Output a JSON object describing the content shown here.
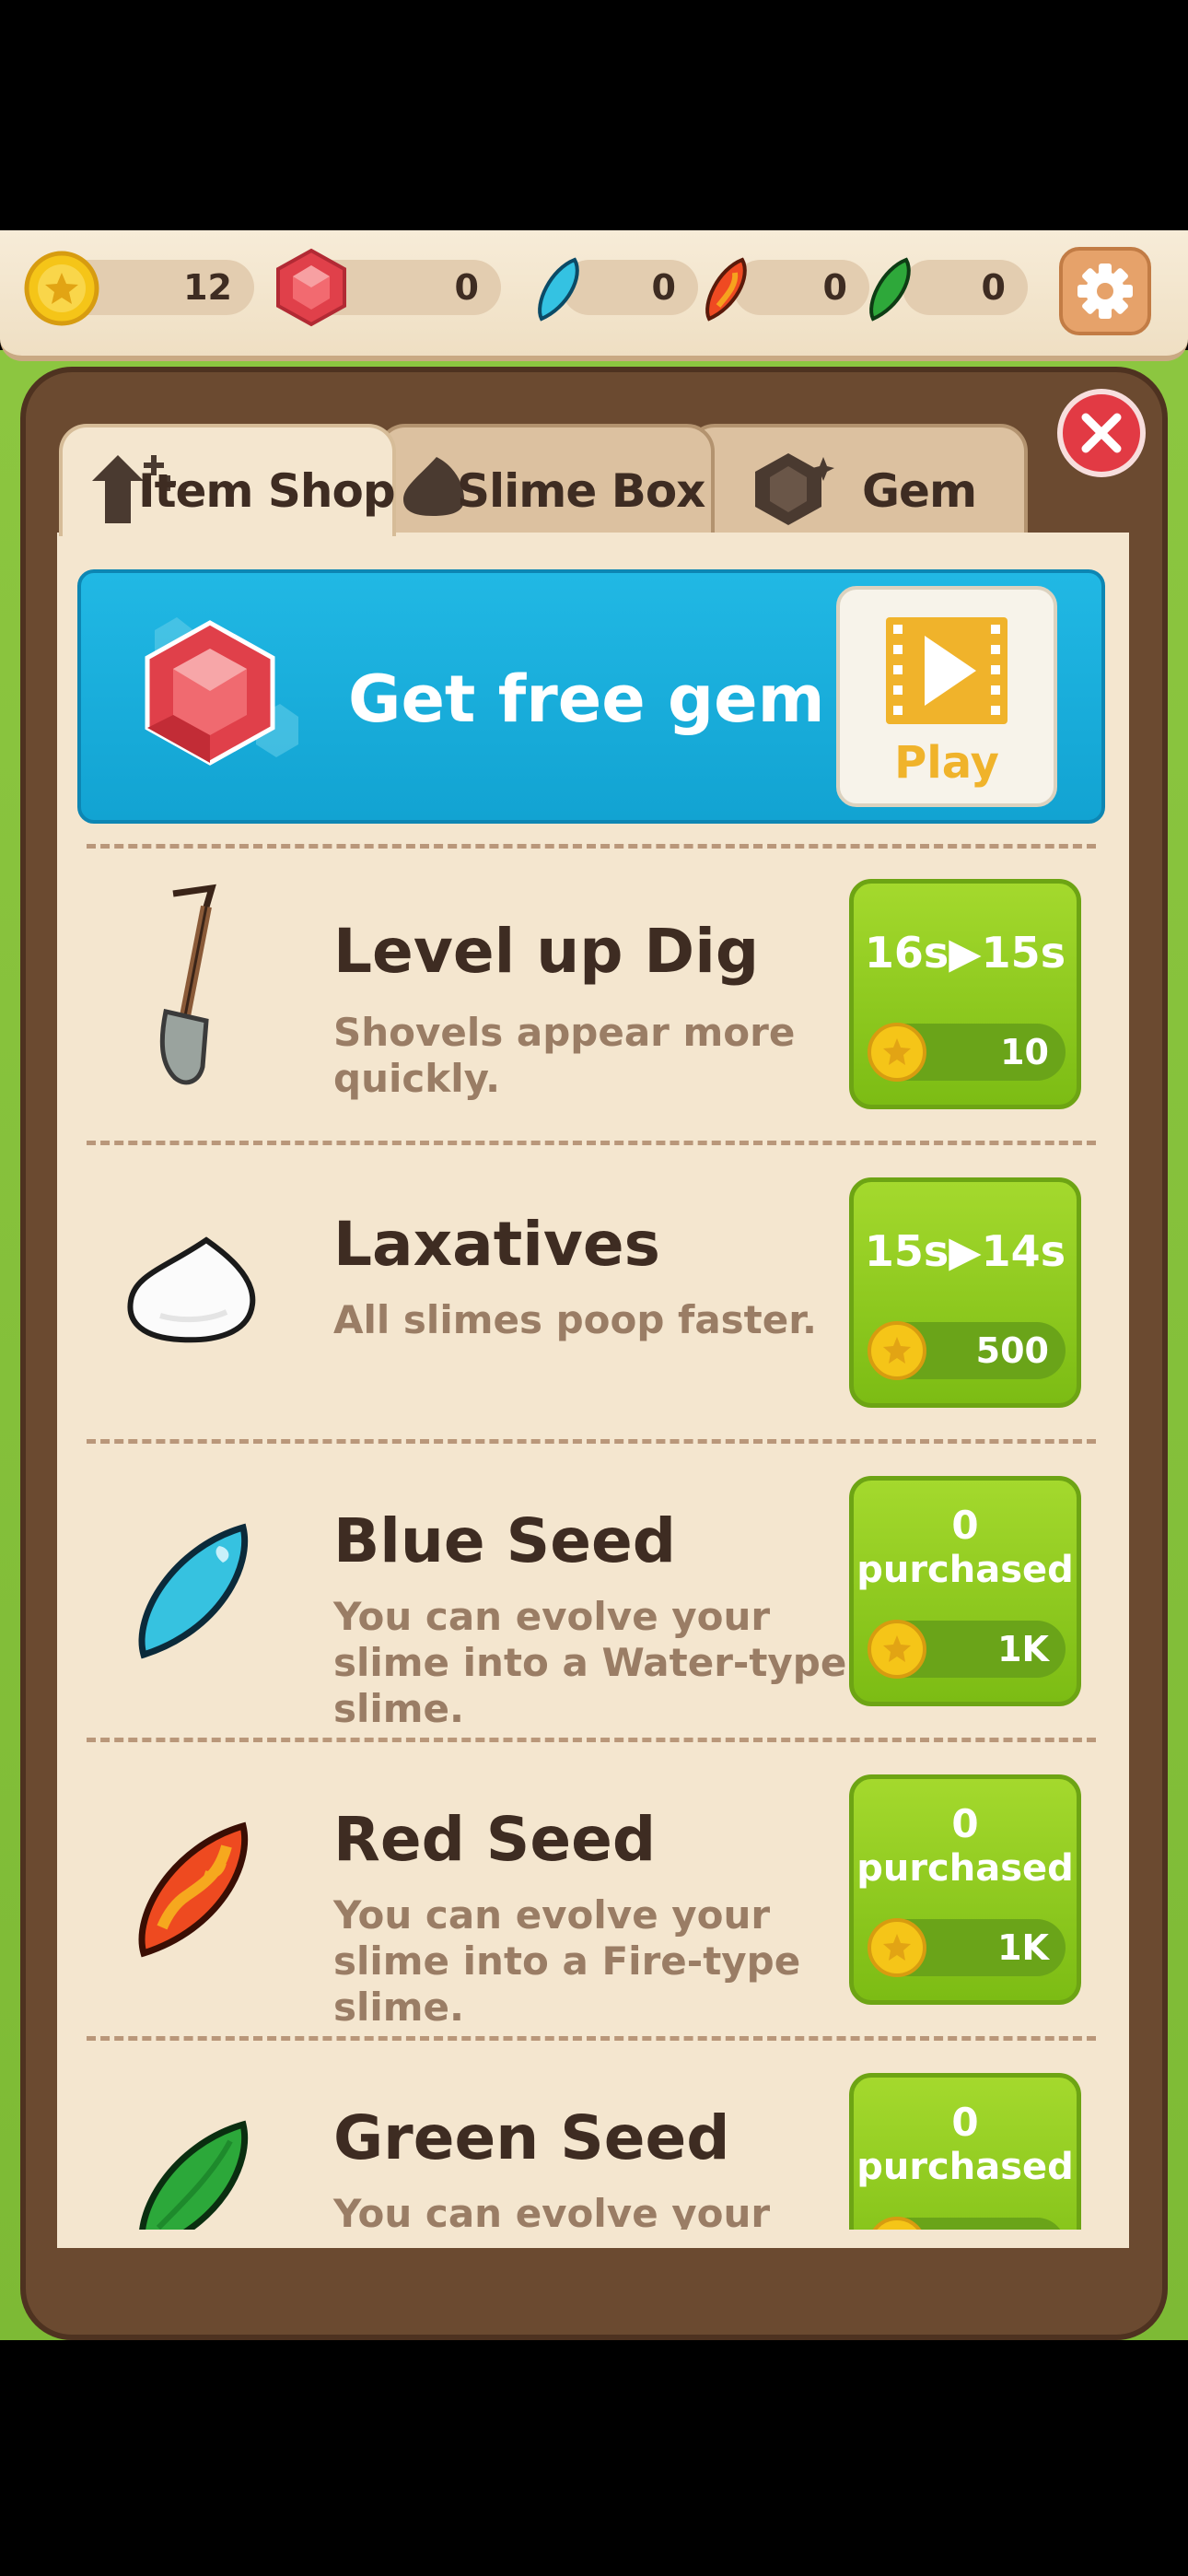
{
  "currency": {
    "coins": "12",
    "gems": "0",
    "blue_seeds": "0",
    "red_seeds": "0",
    "green_seeds": "0"
  },
  "tabs": [
    {
      "label": "Item Shop",
      "active": true
    },
    {
      "label": "Slime Box",
      "active": false
    },
    {
      "label": "Gem",
      "active": false
    }
  ],
  "banner": {
    "title": "Get free gem",
    "play_label": "Play"
  },
  "items": [
    {
      "title": "Level up Dig",
      "desc": "Shovels appear more quickly.",
      "button_top": "16s▶15s",
      "cost": "10",
      "icon": "shovel-icon"
    },
    {
      "title": "Laxatives",
      "desc": "All slimes poop faster.",
      "button_top": "15s▶14s",
      "cost": "500",
      "icon": "poop-icon"
    },
    {
      "title": "Blue Seed",
      "desc": "You can evolve your slime into a Water-type slime.",
      "button_count": "0",
      "button_label": "purchased",
      "cost": "1K",
      "icon": "blue-seed-icon"
    },
    {
      "title": "Red Seed",
      "desc": "You can evolve your slime into a Fire-type slime.",
      "button_count": "0",
      "button_label": "purchased",
      "cost": "1K",
      "icon": "red-seed-icon"
    },
    {
      "title": "Green Seed",
      "desc": "You can evolve your slime",
      "button_count": "0",
      "button_label": "purchased",
      "icon": "green-seed-icon"
    }
  ],
  "colors": {
    "coin": "#f5c518",
    "gem": "#e0404a",
    "button_green": "#8fcb1f",
    "banner_blue": "#18acd9"
  }
}
